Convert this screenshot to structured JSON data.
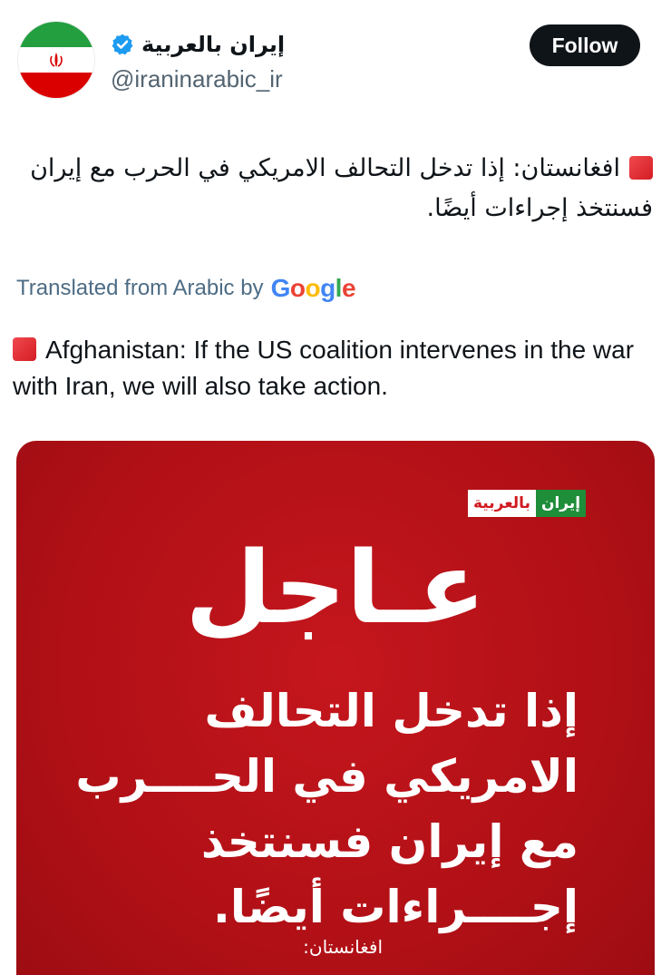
{
  "header": {
    "display_name": "إيران بالعربية",
    "handle": "@iraninarabic_ir",
    "follow_label": "Follow",
    "verified_icon": "verified-badge-icon",
    "avatar": "iran-flag-avatar"
  },
  "tweet": {
    "arabic_text": "افغانستان: إذا تدخل التحالف الامريكي  في الحرب مع إيران فسنتخذ إجراءات أيضًا.",
    "translated_prefix": "Translated from Arabic by",
    "translation_provider": "Google",
    "english_text": "Afghanistan: If the US coalition intervenes in the war with Iran, we will also take action.",
    "marker_icon": "red-square-icon"
  },
  "media": {
    "logo_part_1": "إيران",
    "logo_part_2": "بالعربية",
    "urgent": "عـاجل",
    "headline": "إذا تدخل التحالف الامريكي في الحــــرب مع إيران فسنتخذ إجــــراءات أيضًا.",
    "source": "افغانستان:"
  },
  "colors": {
    "follow_bg": "#0f1419",
    "handle": "#536471",
    "translated": "#4d6c85",
    "media_red": "#c5161d",
    "marker_red": "#e0242c",
    "verified_blue": "#1d9bf0"
  }
}
